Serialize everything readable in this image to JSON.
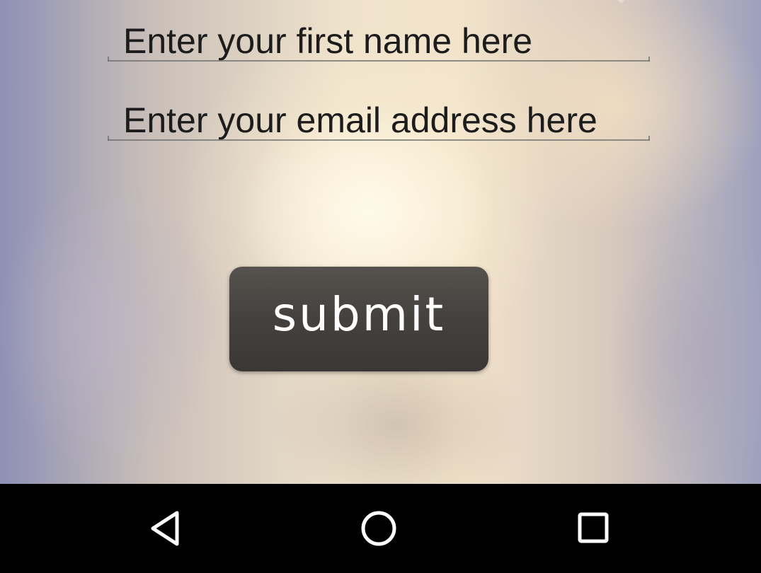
{
  "form": {
    "first_name_placeholder": "Enter your first name here",
    "email_placeholder": "Enter your email address here",
    "submit_label": "submit"
  },
  "navbar": {
    "back_icon": "back-triangle-icon",
    "home_icon": "home-circle-icon",
    "recents_icon": "recents-square-icon"
  },
  "colors": {
    "button_bg": "#46423f",
    "button_text": "#ffffff",
    "field_text": "#1c1c1c",
    "navbar_bg": "#000000",
    "nav_icon": "#ffffff"
  }
}
